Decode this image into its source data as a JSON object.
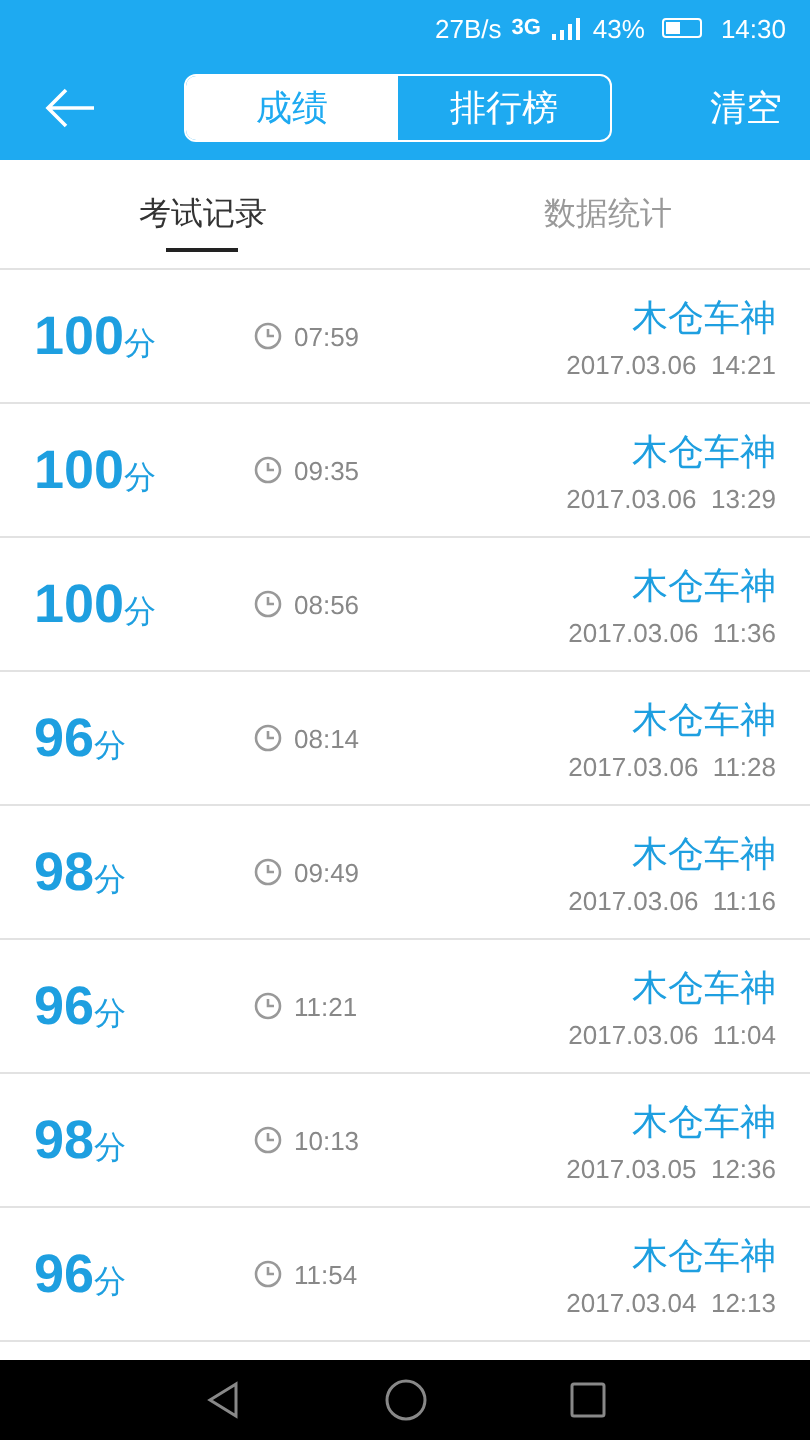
{
  "status_bar": {
    "speed": "27B/s",
    "network": "3G",
    "battery_percent": "43%",
    "time": "14:30"
  },
  "header": {
    "segments": [
      {
        "label": "成绩",
        "selected": true
      },
      {
        "label": "排行榜",
        "selected": false
      }
    ],
    "action": "清空"
  },
  "tabs": [
    {
      "label": "考试记录",
      "selected": true
    },
    {
      "label": "数据统计",
      "selected": false
    }
  ],
  "records": [
    {
      "score": "100",
      "unit": "分",
      "duration": "07:59",
      "name": "木仓车神",
      "date": "2017.03.06  14:21"
    },
    {
      "score": "100",
      "unit": "分",
      "duration": "09:35",
      "name": "木仓车神",
      "date": "2017.03.06  13:29"
    },
    {
      "score": "100",
      "unit": "分",
      "duration": "08:56",
      "name": "木仓车神",
      "date": "2017.03.06  11:36"
    },
    {
      "score": "96",
      "unit": "分",
      "duration": "08:14",
      "name": "木仓车神",
      "date": "2017.03.06  11:28"
    },
    {
      "score": "98",
      "unit": "分",
      "duration": "09:49",
      "name": "木仓车神",
      "date": "2017.03.06  11:16"
    },
    {
      "score": "96",
      "unit": "分",
      "duration": "11:21",
      "name": "木仓车神",
      "date": "2017.03.06  11:04"
    },
    {
      "score": "98",
      "unit": "分",
      "duration": "10:13",
      "name": "木仓车神",
      "date": "2017.03.05  12:36"
    },
    {
      "score": "96",
      "unit": "分",
      "duration": "11:54",
      "name": "木仓车神",
      "date": "2017.03.04  12:13"
    }
  ]
}
